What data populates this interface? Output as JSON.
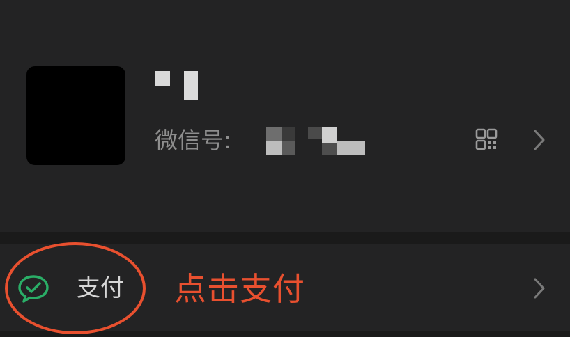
{
  "profile": {
    "wechat_id_label": "微信号:",
    "qr_code_icon": "qr-code-icon",
    "chevron_icon": "chevron-right-icon"
  },
  "pay_row": {
    "label": "支付",
    "icon": "wechat-pay-icon",
    "icon_color": "#2aae67",
    "chevron_icon": "chevron-right-icon"
  },
  "annotation": {
    "text": "点击支付",
    "color": "#e8502f"
  },
  "colors": {
    "background": "#1e1e1e",
    "card": "#232324",
    "secondary_text": "#8e8e8e"
  }
}
